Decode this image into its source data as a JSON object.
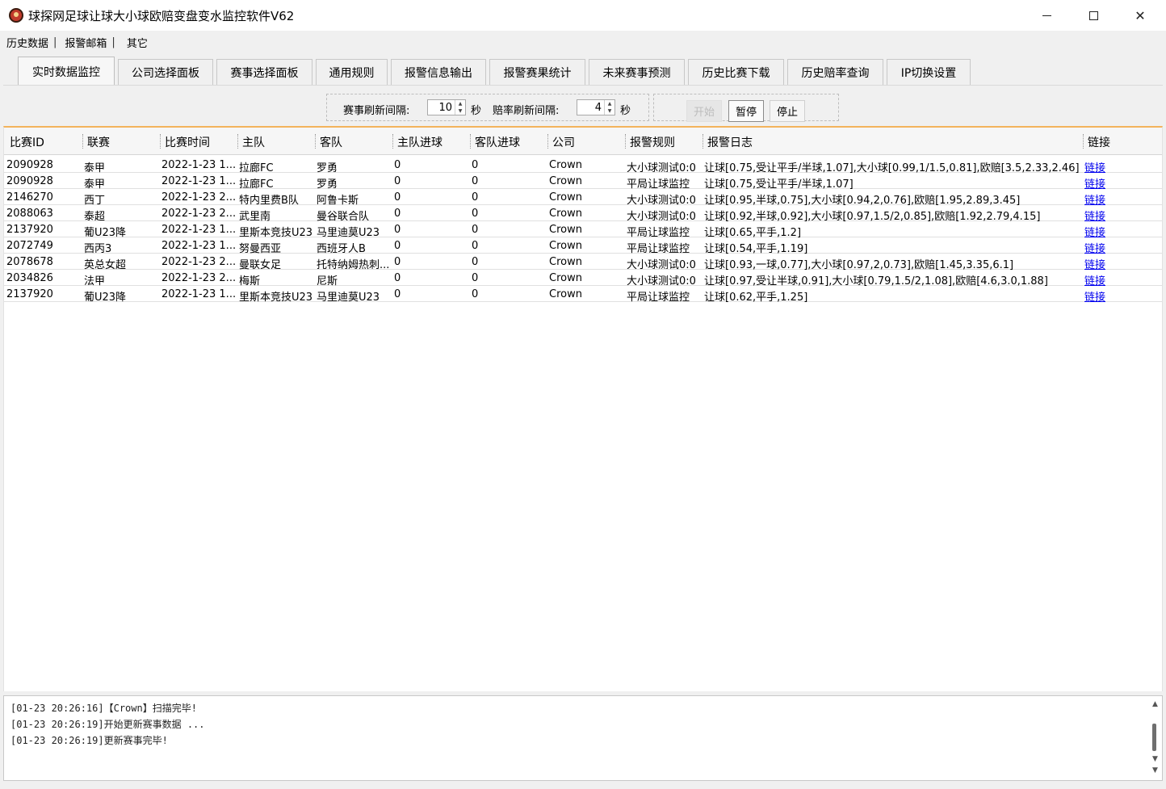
{
  "window": {
    "title": "球探网足球让球大小球欧赔变盘变水监控软件V62",
    "min_glyph": "",
    "close_glyph": "✕"
  },
  "menu": {
    "items": [
      "历史数据",
      "报警邮箱",
      "其它"
    ],
    "separator": "|"
  },
  "tabs": [
    {
      "label": "实时数据监控",
      "active": true
    },
    {
      "label": "公司选择面板"
    },
    {
      "label": "赛事选择面板"
    },
    {
      "label": "通用规则"
    },
    {
      "label": "报警信息输出"
    },
    {
      "label": "报警赛果统计"
    },
    {
      "label": "未来赛事预测"
    },
    {
      "label": "历史比赛下载"
    },
    {
      "label": "历史赔率查询"
    },
    {
      "label": "IP切换设置"
    }
  ],
  "controls": {
    "match_refresh_label": "赛事刷新间隔:",
    "match_refresh_value": "10",
    "odds_refresh_label": "赔率刷新间隔:",
    "odds_refresh_value": "4",
    "unit": "秒",
    "start_label": "开始",
    "pause_label": "暂停",
    "stop_label": "停止"
  },
  "table": {
    "columns": [
      "比赛ID",
      "联赛",
      "比赛时间",
      "主队",
      "客队",
      "主队进球",
      "客队进球",
      "公司",
      "报警规则",
      "报警日志",
      "链接"
    ],
    "rows": [
      [
        "2090928",
        "泰甲",
        "2022-1-23 1...",
        "拉廊FC",
        "罗勇",
        "0",
        "0",
        "Crown",
        "大小球测试0:0",
        "让球[0.75,受让平手/半球,1.07],大小球[0.99,1/1.5,0.81],欧赔[3.5,2.33,2.46]",
        "链接"
      ],
      [
        "2090928",
        "泰甲",
        "2022-1-23 1...",
        "拉廊FC",
        "罗勇",
        "0",
        "0",
        "Crown",
        "平局让球监控",
        "让球[0.75,受让平手/半球,1.07]",
        "链接"
      ],
      [
        "2146270",
        "西丁",
        "2022-1-23 2...",
        "特内里费B队",
        "阿鲁卡斯",
        "0",
        "0",
        "Crown",
        "大小球测试0:0",
        "让球[0.95,半球,0.75],大小球[0.94,2,0.76],欧赔[1.95,2.89,3.45]",
        "链接"
      ],
      [
        "2088063",
        "泰超",
        "2022-1-23 2...",
        "武里南",
        "曼谷联合队",
        "0",
        "0",
        "Crown",
        "大小球测试0:0",
        "让球[0.92,半球,0.92],大小球[0.97,1.5/2,0.85],欧赔[1.92,2.79,4.15]",
        "链接"
      ],
      [
        "2137920",
        "葡U23降",
        "2022-1-23 1...",
        "里斯本竞技U23",
        "马里迪莫U23",
        "0",
        "0",
        "Crown",
        "平局让球监控",
        "让球[0.65,平手,1.2]",
        "链接"
      ],
      [
        "2072749",
        "西丙3",
        "2022-1-23 1...",
        "努曼西亚",
        "西班牙人B",
        "0",
        "0",
        "Crown",
        "平局让球监控",
        "让球[0.54,平手,1.19]",
        "链接"
      ],
      [
        "2078678",
        "英总女超",
        "2022-1-23 2...",
        "曼联女足",
        "托特纳姆热刺...",
        "0",
        "0",
        "Crown",
        "大小球测试0:0",
        "让球[0.93,一球,0.77],大小球[0.97,2,0.73],欧赔[1.45,3.35,6.1]",
        "链接"
      ],
      [
        "2034826",
        "法甲",
        "2022-1-23 2...",
        "梅斯",
        "尼斯",
        "0",
        "0",
        "Crown",
        "大小球测试0:0",
        "让球[0.97,受让半球,0.91],大小球[0.79,1.5/2,1.08],欧赔[4.6,3.0,1.88]",
        "链接"
      ],
      [
        "2137920",
        "葡U23降",
        "2022-1-23 1...",
        "里斯本竞技U23",
        "马里迪莫U23",
        "0",
        "0",
        "Crown",
        "平局让球监控",
        "让球[0.62,平手,1.25]",
        "链接"
      ]
    ]
  },
  "log": {
    "lines": [
      "[01-23 20:26:16]【Crown】扫描完毕!",
      "[01-23 20:26:19]开始更新赛事数据 ...",
      "[01-23 20:26:19]更新赛事完毕!"
    ]
  }
}
